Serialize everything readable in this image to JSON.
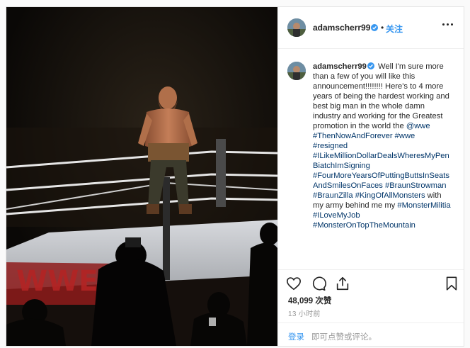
{
  "post": {
    "username": "adamscherr99",
    "follow_label": "关注",
    "dot": "•",
    "caption": {
      "username": "adamscherr99",
      "text_start": "Well I'm sure more than a few of you will like this announcement!!!!!!!! Here's to 4 more years of being the hardest working and best big man in the whole damn industry and working for the Greatest promotion in the world the ",
      "mention": "@wwe",
      "hashtags": [
        "#ThenNowAndForever",
        "#wwe",
        "#resigned",
        "#ILikeMillionDollarDealsWheresMyPenBiatchImSigning",
        "#FourMoreYearsOfPuttingButtsInSeatsAndSmilesOnFaces",
        "#BraunStrowman",
        "#BraunZilla",
        "#KingOfAllMonsters"
      ],
      "text_mid": " with my army behind me my ",
      "hashtags_end": [
        "#MonsterMilitia",
        "#ILoveMyJob",
        "#MonsterOnTopTheMountain"
      ]
    },
    "likes": "48,099 次赞",
    "time_ago": "13 小时前",
    "login_link": "登录",
    "login_text": "即可点赞或评论。",
    "colors": {
      "link": "#3897f0",
      "hashtag": "#003569",
      "verified": "#3897f0"
    },
    "photo": {
      "sign_text": "WWE"
    }
  }
}
